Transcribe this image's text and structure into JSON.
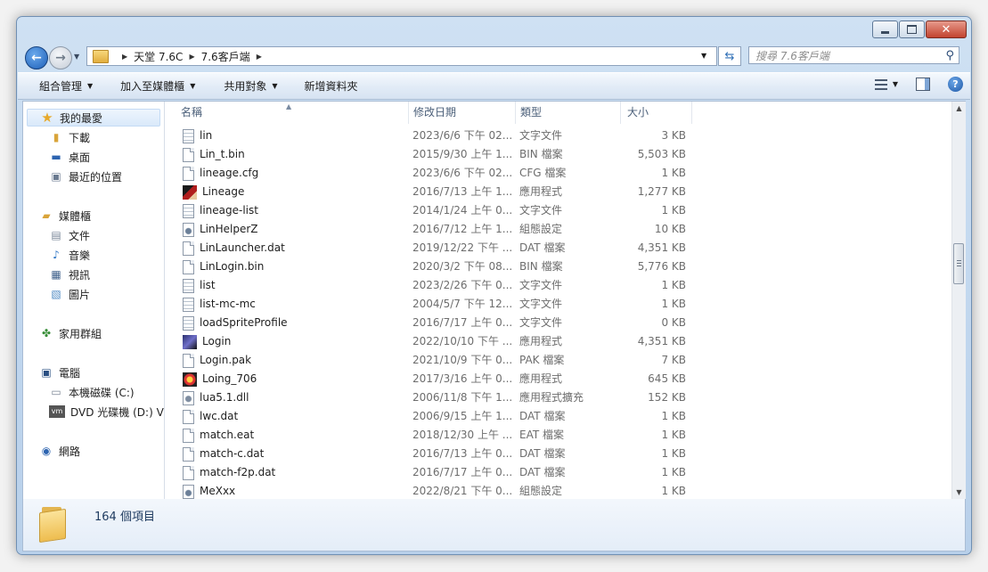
{
  "breadcrumb": [
    "天堂 7.6C",
    "7.6客戶端"
  ],
  "search": {
    "placeholder": "搜尋 7.6客戶端"
  },
  "toolbar": {
    "organize": "組合管理",
    "include_in_library": "加入至媒體櫃",
    "share_with": "共用對象",
    "new_folder": "新增資料夾"
  },
  "nav": {
    "favorites": "我的最愛",
    "downloads": "下載",
    "desktop": "桌面",
    "recent_places": "最近的位置",
    "libraries": "媒體櫃",
    "documents": "文件",
    "music": "音樂",
    "videos": "視訊",
    "pictures": "圖片",
    "homegroup": "家用群組",
    "computer": "電腦",
    "local_disk": "本機磁碟 (C:)",
    "dvd_drive": "DVD 光碟機 (D:) VM",
    "network": "網路"
  },
  "columns": {
    "name": "名稱",
    "date": "修改日期",
    "type": "類型",
    "size": "大小"
  },
  "files": [
    {
      "name": "lin",
      "date": "2023/6/6 下午 02...",
      "type": "文字文件",
      "size": "3 KB",
      "icon": "text-file-icon"
    },
    {
      "name": "Lin_t.bin",
      "date": "2015/9/30 上午 1...",
      "type": "BIN 檔案",
      "size": "5,503 KB",
      "icon": "file-icon"
    },
    {
      "name": "lineage.cfg",
      "date": "2023/6/6 下午 02...",
      "type": "CFG 檔案",
      "size": "1 KB",
      "icon": "file-icon"
    },
    {
      "name": "Lineage",
      "date": "2016/7/13 上午 1...",
      "type": "應用程式",
      "size": "1,277 KB",
      "icon": "lineage-app-icon"
    },
    {
      "name": "lineage-list",
      "date": "2014/1/24 上午 0...",
      "type": "文字文件",
      "size": "1 KB",
      "icon": "text-file-icon"
    },
    {
      "name": "LinHelperZ",
      "date": "2016/7/12 上午 1...",
      "type": "組態設定",
      "size": "10 KB",
      "icon": "config-settings-icon"
    },
    {
      "name": "LinLauncher.dat",
      "date": "2019/12/22 下午 ...",
      "type": "DAT 檔案",
      "size": "4,351 KB",
      "icon": "file-icon"
    },
    {
      "name": "LinLogin.bin",
      "date": "2020/3/2 下午 08...",
      "type": "BIN 檔案",
      "size": "5,776 KB",
      "icon": "file-icon"
    },
    {
      "name": "list",
      "date": "2023/2/26 下午 0...",
      "type": "文字文件",
      "size": "1 KB",
      "icon": "text-file-icon"
    },
    {
      "name": "list-mc-mc",
      "date": "2004/5/7 下午 12...",
      "type": "文字文件",
      "size": "1 KB",
      "icon": "text-file-icon"
    },
    {
      "name": "loadSpriteProfile",
      "date": "2016/7/17 上午 0...",
      "type": "文字文件",
      "size": "0 KB",
      "icon": "text-file-icon"
    },
    {
      "name": "Login",
      "date": "2022/10/10 下午 ...",
      "type": "應用程式",
      "size": "4,351 KB",
      "icon": "login-app-icon"
    },
    {
      "name": "Login.pak",
      "date": "2021/10/9 下午 0...",
      "type": "PAK 檔案",
      "size": "7 KB",
      "icon": "file-icon"
    },
    {
      "name": "Loing_706",
      "date": "2017/3/16 上午 0...",
      "type": "應用程式",
      "size": "645 KB",
      "icon": "loing-app-icon"
    },
    {
      "name": "lua5.1.dll",
      "date": "2006/11/8 下午 1...",
      "type": "應用程式擴充",
      "size": "152 KB",
      "icon": "dll-file-icon"
    },
    {
      "name": "lwc.dat",
      "date": "2006/9/15 上午 1...",
      "type": "DAT 檔案",
      "size": "1 KB",
      "icon": "file-icon"
    },
    {
      "name": "match.eat",
      "date": "2018/12/30 上午 ...",
      "type": "EAT 檔案",
      "size": "1 KB",
      "icon": "file-icon"
    },
    {
      "name": "match-c.dat",
      "date": "2016/7/13 上午 0...",
      "type": "DAT 檔案",
      "size": "1 KB",
      "icon": "file-icon"
    },
    {
      "name": "match-f2p.dat",
      "date": "2016/7/17 上午 0...",
      "type": "DAT 檔案",
      "size": "1 KB",
      "icon": "file-icon"
    },
    {
      "name": "MeXxx",
      "date": "2022/8/21 下午 0...",
      "type": "組態設定",
      "size": "1 KB",
      "icon": "config-settings-icon"
    }
  ],
  "status": {
    "item_count": "164 個項目"
  }
}
